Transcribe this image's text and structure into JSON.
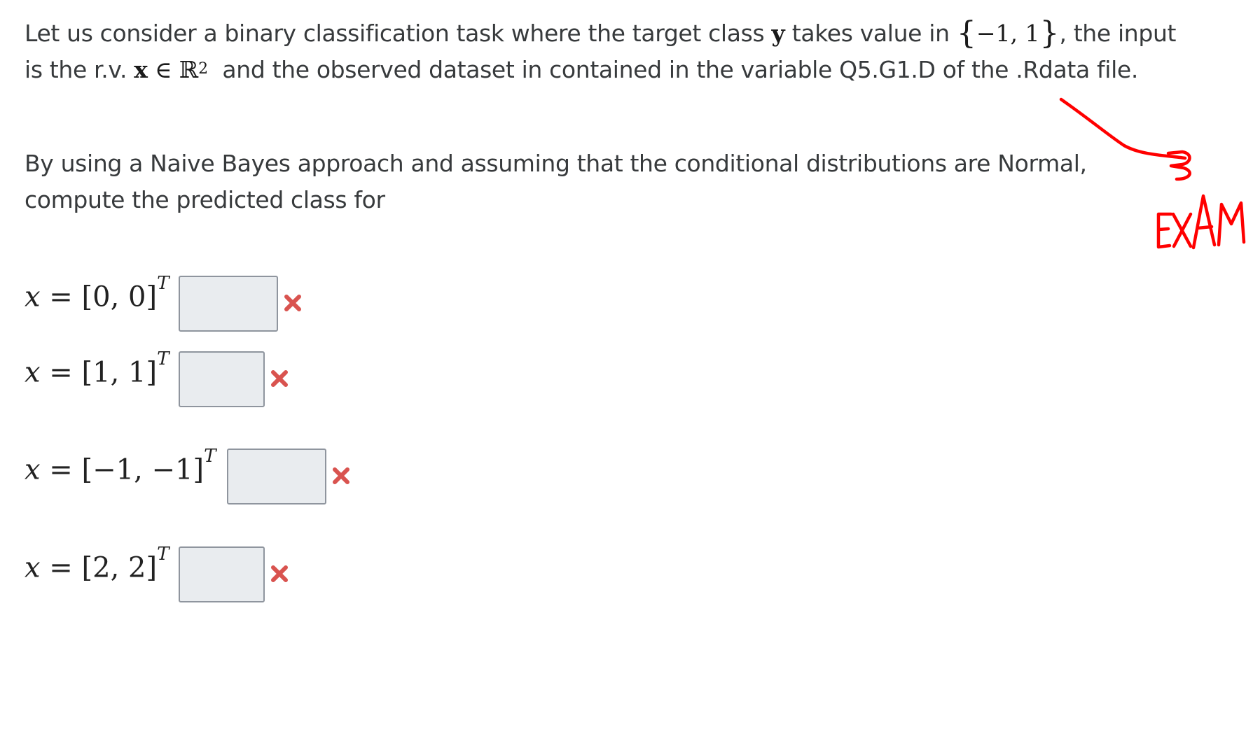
{
  "question": {
    "intro": {
      "part1": "Let us consider a binary classification task where the target class",
      "target_var": "y",
      "part2": "takes value in",
      "set_values": "−1, 1",
      "part3": ", the input",
      "part4": "is the r.v.",
      "input_var": "x",
      "element_of": "∈",
      "reals": "ℝ",
      "dim": "2",
      "part5": "and the observed dataset in contained in the variable Q5.G1.D of the .Rdata file."
    },
    "instruction": {
      "line1": "By using a Naive Bayes approach and assuming that  the conditional distributions are Normal,",
      "line2": "compute the predicted class for"
    },
    "items": [
      {
        "lhs": "x",
        "rhs": "= [0, 0]",
        "transpose": "T",
        "answer": ""
      },
      {
        "lhs": "x",
        "rhs": "= [1, 1]",
        "transpose": "T",
        "answer": ""
      },
      {
        "lhs": "x",
        "rhs": "= [−1, −1]",
        "transpose": "T",
        "answer": ""
      },
      {
        "lhs": "x",
        "rhs": "= [2, 2]",
        "transpose": "T",
        "answer": ""
      }
    ]
  },
  "annotation": {
    "text": "EXAM",
    "color": "#ff0000"
  },
  "colors": {
    "incorrect_mark": "#d9534f",
    "input_background": "#e9ecef",
    "text": "#373a3c"
  }
}
